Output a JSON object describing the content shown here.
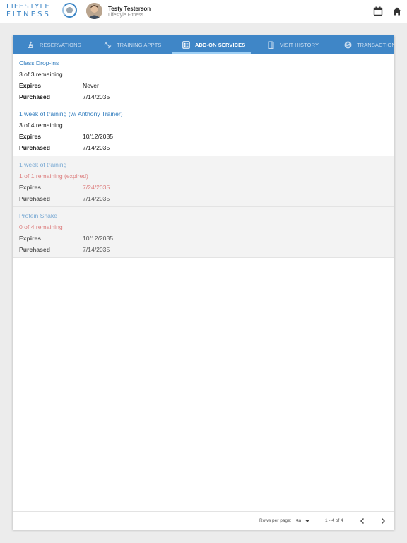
{
  "header": {
    "logo_line1": "LIFESTYLE",
    "logo_line2": "FITNESS",
    "user_name": "Testy Testerson",
    "user_subtitle": "Lifestyle Fitness",
    "icons": [
      "calendar-icon",
      "home-icon"
    ]
  },
  "tabs": [
    {
      "label": "Reservations",
      "icon": "reservation-icon",
      "active": false
    },
    {
      "label": "Training Appts",
      "icon": "dumbbell-icon",
      "active": false
    },
    {
      "label": "Add-On Services",
      "icon": "services-list-icon",
      "active": true
    },
    {
      "label": "Visit History",
      "icon": "door-icon",
      "active": false
    },
    {
      "label": "Transactions",
      "icon": "dollar-icon",
      "active": false
    }
  ],
  "field_labels": {
    "expires": "Expires",
    "purchased": "Purchased"
  },
  "services": [
    {
      "title": "Class Drop-ins",
      "remaining": "3 of 3 remaining",
      "expires": "Never",
      "purchased": "7/14/2035",
      "expired": false
    },
    {
      "title": "1 week of training (w/ Anthony Trainer)",
      "remaining": "3 of 4 remaining",
      "expires": "10/12/2035",
      "purchased": "7/14/2035",
      "expired": false
    },
    {
      "title": "1 week of training",
      "remaining": "1 of 1 remaining (expired)",
      "expires": "7/24/2035",
      "purchased": "7/14/2035",
      "expired": true
    },
    {
      "title": "Protein Shake",
      "remaining": "0 of 4 remaining",
      "expires": "10/12/2035",
      "purchased": "7/14/2035",
      "expired": true
    }
  ],
  "pagination": {
    "rows_per_page_label": "Rows per page:",
    "rows_per_page_value": "50",
    "range_text": "1 - 4 of 4"
  },
  "colors": {
    "tab_bar": "#3f86c7",
    "link": "#2f7bbd",
    "expired_text": "#dd7f7f"
  }
}
